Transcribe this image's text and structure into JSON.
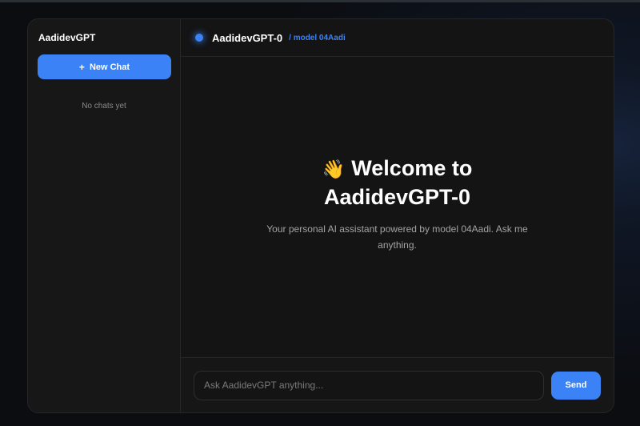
{
  "sidebar": {
    "brand": "AadidevGPT",
    "new_chat_icon": "+",
    "new_chat_label": "New Chat",
    "empty_state": "No chats yet"
  },
  "header": {
    "title": "AadidevGPT-0",
    "model_tag": "/ model 04Aadi",
    "status_color": "#3b82f6"
  },
  "welcome": {
    "emoji": "👋",
    "title": "Welcome to AadidevGPT-0",
    "subtitle": "Your personal AI assistant powered by model 04Aadi. Ask me anything."
  },
  "composer": {
    "placeholder": "Ask AadidevGPT anything...",
    "value": "",
    "send_label": "Send"
  },
  "colors": {
    "accent": "#3b82f6",
    "panel": "#141414",
    "sidebar": "#171717"
  }
}
